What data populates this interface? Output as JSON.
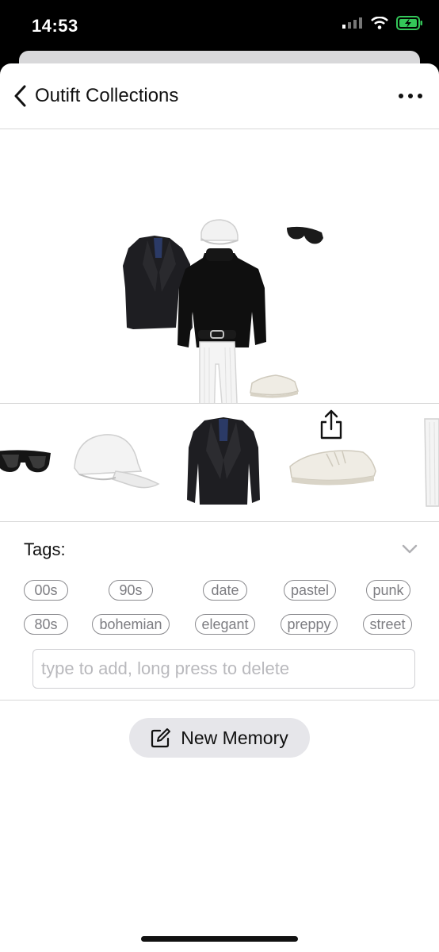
{
  "status": {
    "time": "14:53"
  },
  "nav": {
    "title": "Outift Collections"
  },
  "tags": {
    "header": "Tags:",
    "items": [
      "00s",
      "90s",
      "date",
      "pastel",
      "punk",
      "80s",
      "bohemian",
      "elegant",
      "preppy",
      "street"
    ],
    "input_placeholder": "type to add, long press to delete"
  },
  "actions": {
    "new_memory": "New Memory"
  },
  "colors": {
    "battery": "#34c759",
    "chip_border": "#8a8a8e",
    "button_bg": "#e6e6ea"
  }
}
